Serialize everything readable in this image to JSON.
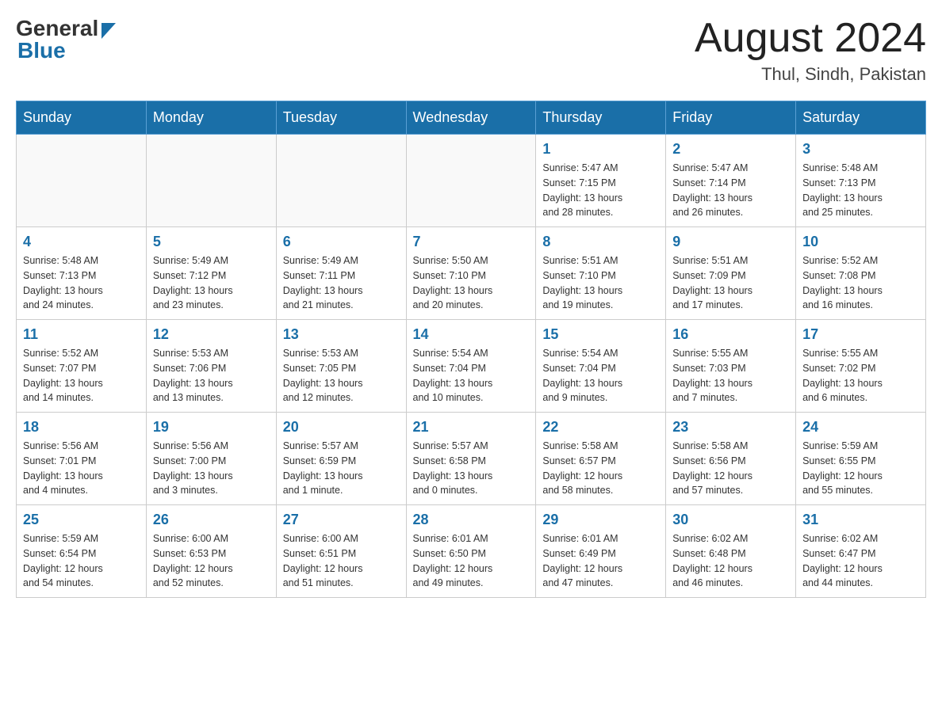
{
  "header": {
    "logo_general": "General",
    "logo_blue": "Blue",
    "month_title": "August 2024",
    "location": "Thul, Sindh, Pakistan"
  },
  "weekdays": [
    "Sunday",
    "Monday",
    "Tuesday",
    "Wednesday",
    "Thursday",
    "Friday",
    "Saturday"
  ],
  "weeks": [
    [
      {
        "day": "",
        "info": ""
      },
      {
        "day": "",
        "info": ""
      },
      {
        "day": "",
        "info": ""
      },
      {
        "day": "",
        "info": ""
      },
      {
        "day": "1",
        "info": "Sunrise: 5:47 AM\nSunset: 7:15 PM\nDaylight: 13 hours\nand 28 minutes."
      },
      {
        "day": "2",
        "info": "Sunrise: 5:47 AM\nSunset: 7:14 PM\nDaylight: 13 hours\nand 26 minutes."
      },
      {
        "day": "3",
        "info": "Sunrise: 5:48 AM\nSunset: 7:13 PM\nDaylight: 13 hours\nand 25 minutes."
      }
    ],
    [
      {
        "day": "4",
        "info": "Sunrise: 5:48 AM\nSunset: 7:13 PM\nDaylight: 13 hours\nand 24 minutes."
      },
      {
        "day": "5",
        "info": "Sunrise: 5:49 AM\nSunset: 7:12 PM\nDaylight: 13 hours\nand 23 minutes."
      },
      {
        "day": "6",
        "info": "Sunrise: 5:49 AM\nSunset: 7:11 PM\nDaylight: 13 hours\nand 21 minutes."
      },
      {
        "day": "7",
        "info": "Sunrise: 5:50 AM\nSunset: 7:10 PM\nDaylight: 13 hours\nand 20 minutes."
      },
      {
        "day": "8",
        "info": "Sunrise: 5:51 AM\nSunset: 7:10 PM\nDaylight: 13 hours\nand 19 minutes."
      },
      {
        "day": "9",
        "info": "Sunrise: 5:51 AM\nSunset: 7:09 PM\nDaylight: 13 hours\nand 17 minutes."
      },
      {
        "day": "10",
        "info": "Sunrise: 5:52 AM\nSunset: 7:08 PM\nDaylight: 13 hours\nand 16 minutes."
      }
    ],
    [
      {
        "day": "11",
        "info": "Sunrise: 5:52 AM\nSunset: 7:07 PM\nDaylight: 13 hours\nand 14 minutes."
      },
      {
        "day": "12",
        "info": "Sunrise: 5:53 AM\nSunset: 7:06 PM\nDaylight: 13 hours\nand 13 minutes."
      },
      {
        "day": "13",
        "info": "Sunrise: 5:53 AM\nSunset: 7:05 PM\nDaylight: 13 hours\nand 12 minutes."
      },
      {
        "day": "14",
        "info": "Sunrise: 5:54 AM\nSunset: 7:04 PM\nDaylight: 13 hours\nand 10 minutes."
      },
      {
        "day": "15",
        "info": "Sunrise: 5:54 AM\nSunset: 7:04 PM\nDaylight: 13 hours\nand 9 minutes."
      },
      {
        "day": "16",
        "info": "Sunrise: 5:55 AM\nSunset: 7:03 PM\nDaylight: 13 hours\nand 7 minutes."
      },
      {
        "day": "17",
        "info": "Sunrise: 5:55 AM\nSunset: 7:02 PM\nDaylight: 13 hours\nand 6 minutes."
      }
    ],
    [
      {
        "day": "18",
        "info": "Sunrise: 5:56 AM\nSunset: 7:01 PM\nDaylight: 13 hours\nand 4 minutes."
      },
      {
        "day": "19",
        "info": "Sunrise: 5:56 AM\nSunset: 7:00 PM\nDaylight: 13 hours\nand 3 minutes."
      },
      {
        "day": "20",
        "info": "Sunrise: 5:57 AM\nSunset: 6:59 PM\nDaylight: 13 hours\nand 1 minute."
      },
      {
        "day": "21",
        "info": "Sunrise: 5:57 AM\nSunset: 6:58 PM\nDaylight: 13 hours\nand 0 minutes."
      },
      {
        "day": "22",
        "info": "Sunrise: 5:58 AM\nSunset: 6:57 PM\nDaylight: 12 hours\nand 58 minutes."
      },
      {
        "day": "23",
        "info": "Sunrise: 5:58 AM\nSunset: 6:56 PM\nDaylight: 12 hours\nand 57 minutes."
      },
      {
        "day": "24",
        "info": "Sunrise: 5:59 AM\nSunset: 6:55 PM\nDaylight: 12 hours\nand 55 minutes."
      }
    ],
    [
      {
        "day": "25",
        "info": "Sunrise: 5:59 AM\nSunset: 6:54 PM\nDaylight: 12 hours\nand 54 minutes."
      },
      {
        "day": "26",
        "info": "Sunrise: 6:00 AM\nSunset: 6:53 PM\nDaylight: 12 hours\nand 52 minutes."
      },
      {
        "day": "27",
        "info": "Sunrise: 6:00 AM\nSunset: 6:51 PM\nDaylight: 12 hours\nand 51 minutes."
      },
      {
        "day": "28",
        "info": "Sunrise: 6:01 AM\nSunset: 6:50 PM\nDaylight: 12 hours\nand 49 minutes."
      },
      {
        "day": "29",
        "info": "Sunrise: 6:01 AM\nSunset: 6:49 PM\nDaylight: 12 hours\nand 47 minutes."
      },
      {
        "day": "30",
        "info": "Sunrise: 6:02 AM\nSunset: 6:48 PM\nDaylight: 12 hours\nand 46 minutes."
      },
      {
        "day": "31",
        "info": "Sunrise: 6:02 AM\nSunset: 6:47 PM\nDaylight: 12 hours\nand 44 minutes."
      }
    ]
  ]
}
